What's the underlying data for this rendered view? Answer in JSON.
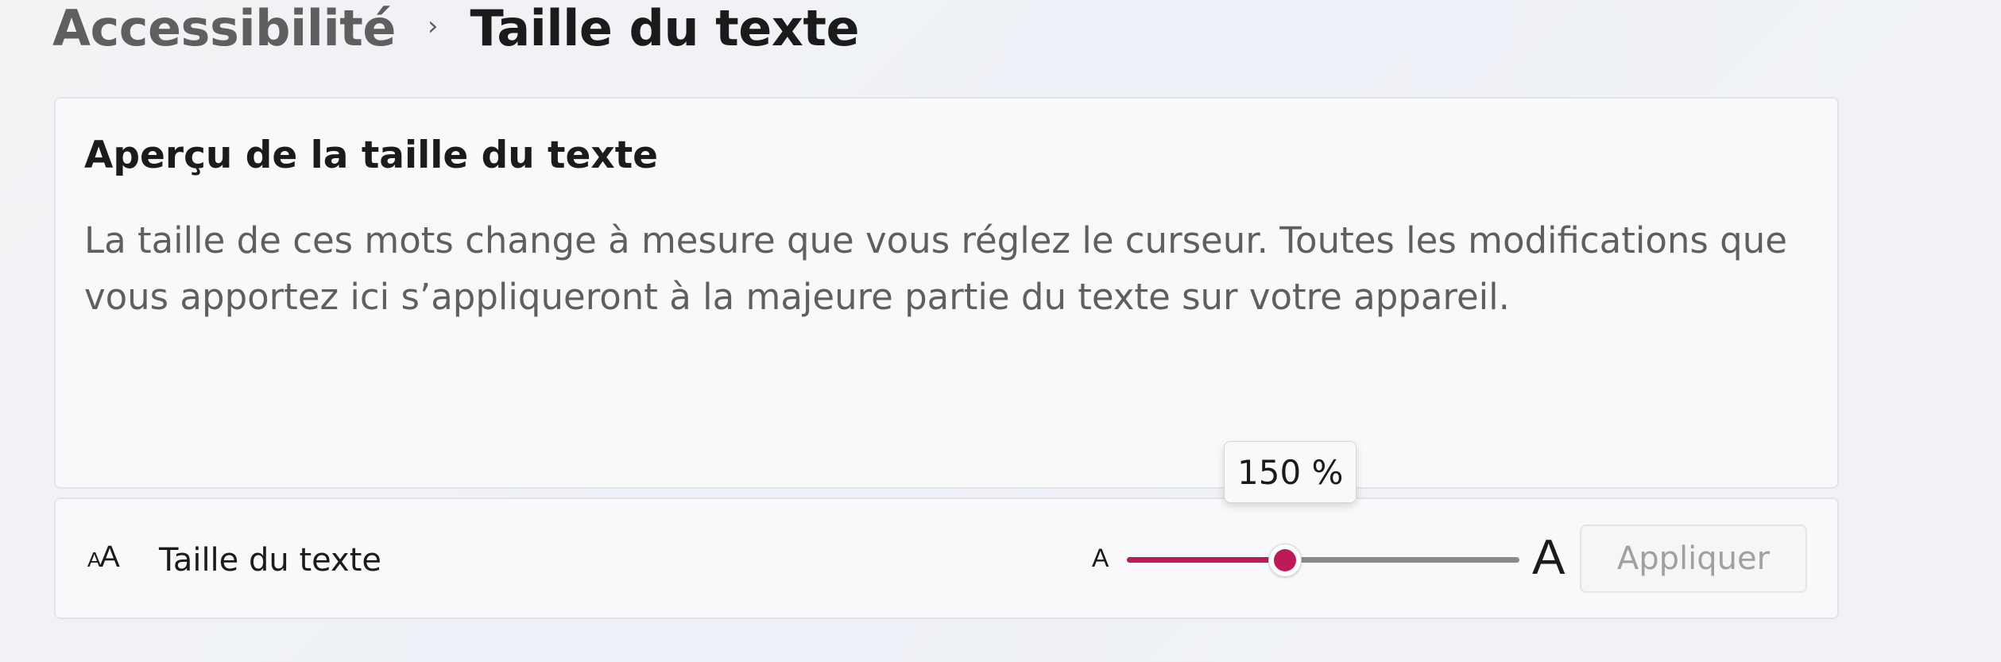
{
  "breadcrumb": {
    "parent": "Accessibilité",
    "separator": "›",
    "current": "Taille du texte"
  },
  "preview": {
    "title": "Aperçu de la taille du texte",
    "body": "La taille de ces mots change à mesure que vous réglez le curseur. Toutes les modifications que vous apportez ici s’appliqueront à la majeure partie du texte sur votre appareil."
  },
  "setting": {
    "icon": "text-size-icon",
    "icon_glyph_small": "A",
    "icon_glyph_large": "A",
    "label": "Taille du texte",
    "slider": {
      "min_label": "A",
      "max_label": "A",
      "min": 100,
      "max": 225,
      "value": 150,
      "value_text": "150 %",
      "accent_color": "#be1a5a"
    },
    "apply_label": "Appliquer"
  }
}
